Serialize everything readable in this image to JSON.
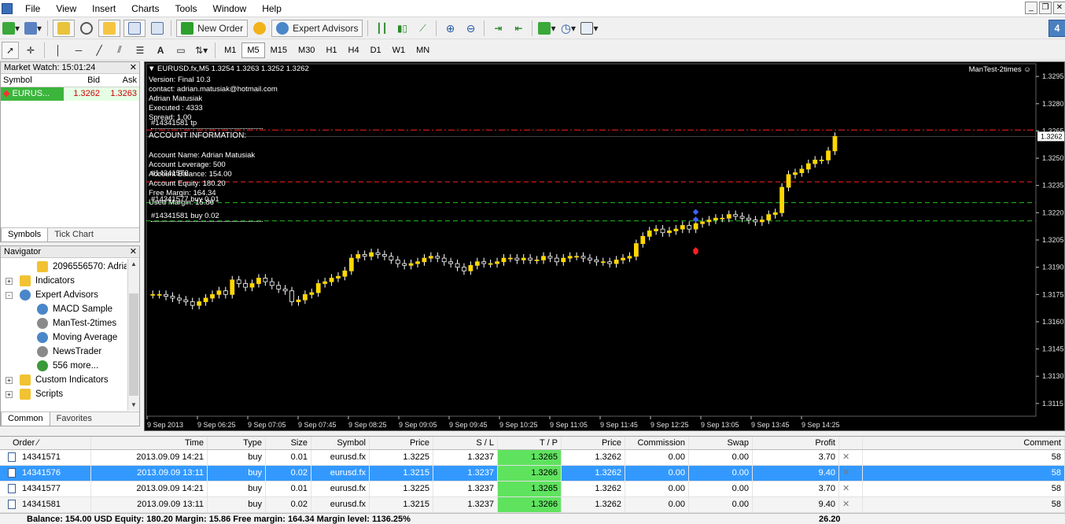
{
  "menu": [
    "File",
    "View",
    "Insert",
    "Charts",
    "Tools",
    "Window",
    "Help"
  ],
  "toolbar": {
    "new_order": "New Order",
    "expert_advisors": "Expert Advisors",
    "badge": "4",
    "timeframes": [
      "M1",
      "M5",
      "M15",
      "M30",
      "H1",
      "H4",
      "D1",
      "W1",
      "MN"
    ],
    "active_timeframe": "M5"
  },
  "market_watch": {
    "title": "Market Watch: 15:01:24",
    "columns": [
      "Symbol",
      "Bid",
      "Ask"
    ],
    "rows": [
      {
        "symbol": "EURUS...",
        "bid": "1.3262",
        "ask": "1.3263"
      }
    ],
    "tabs": [
      "Symbols",
      "Tick Chart"
    ]
  },
  "navigator": {
    "title": "Navigator",
    "items": [
      {
        "label": "2096556570: Adria",
        "icon": "account-icon",
        "indent": 2
      },
      {
        "label": "Indicators",
        "icon": "indicators-icon",
        "indent": 1,
        "expander": "+"
      },
      {
        "label": "Expert Advisors",
        "icon": "expert-icon",
        "indent": 1,
        "expander": "-"
      },
      {
        "label": "MACD Sample",
        "icon": "expert-icon",
        "indent": 2
      },
      {
        "label": "ManTest-2times",
        "icon": "expert-gray-icon",
        "indent": 2
      },
      {
        "label": "Moving Average",
        "icon": "expert-icon",
        "indent": 2
      },
      {
        "label": "NewsTrader",
        "icon": "expert-gray-icon",
        "indent": 2
      },
      {
        "label": "556 more...",
        "icon": "globe-icon",
        "indent": 2
      },
      {
        "label": "Custom Indicators",
        "icon": "indicators-icon",
        "indent": 1,
        "expander": "+"
      },
      {
        "label": "Scripts",
        "icon": "scripts-icon",
        "indent": 1,
        "expander": "+"
      }
    ],
    "tabs": [
      "Common",
      "Favorites"
    ]
  },
  "chart_panel": {
    "header": "EURUSD.fx,M5  1.3254 1.3263 1.3252 1.3262",
    "expert_name": "ManTest-2times",
    "info_lines": [
      "Version: Final 10.3",
      "contact: adrian.matusiak@hotmail.com",
      "Adrian Matusiak",
      "Executed : 4333",
      "Spread: 1.00"
    ],
    "account_title": "ACCOUNT INFORMATION:",
    "account_lines": [
      "Account Name:     Adrian Matusiak",
      "Account Leverage:     500",
      "Account Balance:     154.00",
      "Account Equity:     180.20",
      "Free Margin:     164.34",
      "Used Margin:     15.86"
    ],
    "line_labels": [
      "#14341581 tp",
      "#14341576",
      "#14341577 buy 0.01",
      "#14341581 buy 0.02"
    ],
    "current_price": "1.3262",
    "colors": {
      "candle": "#ffd700",
      "tp_line": "#ff2020",
      "sl_line": "#ff2020",
      "buy_line": "#20c020",
      "grid": "#505050"
    }
  },
  "chart_data": {
    "type": "candlestick",
    "symbol": "EURUSD.fx",
    "timeframe": "M5",
    "ylim": [
      1.3108,
      1.3302
    ],
    "y_ticks": [
      1.3295,
      1.328,
      1.3265,
      1.325,
      1.3235,
      1.322,
      1.3205,
      1.319,
      1.3175,
      1.316,
      1.3145,
      1.313,
      1.3115
    ],
    "x_ticks": [
      "9 Sep 2013",
      "9 Sep 06:25",
      "9 Sep 07:05",
      "9 Sep 07:45",
      "9 Sep 08:25",
      "9 Sep 09:05",
      "9 Sep 09:45",
      "9 Sep 10:25",
      "9 Sep 11:05",
      "9 Sep 11:45",
      "9 Sep 12:25",
      "9 Sep 13:05",
      "9 Sep 13:45",
      "9 Sep 14:25"
    ],
    "horizontal_lines": [
      {
        "price": 1.32655,
        "style": "dashdot",
        "color": "#ff2020"
      },
      {
        "price": 1.3237,
        "style": "dash",
        "color": "#ff2020"
      },
      {
        "price": 1.32255,
        "style": "dash",
        "color": "#20c020"
      },
      {
        "price": 1.32155,
        "style": "dash",
        "color": "#20c020"
      }
    ],
    "closes": [
      1.3175,
      1.3175,
      1.3174,
      1.3173,
      1.3172,
      1.3171,
      1.3169,
      1.3171,
      1.3173,
      1.3175,
      1.3177,
      1.3175,
      1.3183,
      1.3181,
      1.3179,
      1.3181,
      1.3184,
      1.3182,
      1.318,
      1.3178,
      1.3177,
      1.3171,
      1.3172,
      1.3175,
      1.3176,
      1.3181,
      1.3182,
      1.3184,
      1.3185,
      1.3188,
      1.3195,
      1.3197,
      1.3196,
      1.3198,
      1.3197,
      1.3196,
      1.3194,
      1.3192,
      1.3191,
      1.3192,
      1.3193,
      1.3195,
      1.3196,
      1.3195,
      1.3193,
      1.3192,
      1.319,
      1.3188,
      1.3191,
      1.3193,
      1.3192,
      1.3192,
      1.3193,
      1.3195,
      1.3195,
      1.3194,
      1.3195,
      1.3194,
      1.3194,
      1.3196,
      1.3195,
      1.3193,
      1.3195,
      1.3196,
      1.3196,
      1.3195,
      1.3194,
      1.3193,
      1.3193,
      1.3192,
      1.3194,
      1.3195,
      1.3196,
      1.3203,
      1.3207,
      1.321,
      1.3211,
      1.3209,
      1.321,
      1.3211,
      1.3213,
      1.3211,
      1.3214,
      1.3215,
      1.3216,
      1.3217,
      1.3217,
      1.3219,
      1.3218,
      1.3217,
      1.3216,
      1.3215,
      1.3216,
      1.3219,
      1.322,
      1.3234,
      1.3241,
      1.3242,
      1.3244,
      1.3247,
      1.3249,
      1.3249,
      1.3254,
      1.3262
    ]
  },
  "terminal": {
    "columns": [
      "Order",
      "Time",
      "Type",
      "Size",
      "Symbol",
      "Price",
      "S / L",
      "T / P",
      "Price",
      "Commission",
      "Swap",
      "Profit",
      "",
      "Comment"
    ],
    "rows": [
      {
        "order": "14341571",
        "time": "2013.09.09 14:21",
        "type": "buy",
        "size": "0.01",
        "symbol": "eurusd.fx",
        "price": "1.3225",
        "sl": "1.3237",
        "tp": "1.3265",
        "cur": "1.3262",
        "commission": "0.00",
        "swap": "0.00",
        "profit": "3.70",
        "comment": "58"
      },
      {
        "order": "14341576",
        "time": "2013.09.09 13:11",
        "type": "buy",
        "size": "0.02",
        "symbol": "eurusd.fx",
        "price": "1.3215",
        "sl": "1.3237",
        "tp": "1.3266",
        "cur": "1.3262",
        "commission": "0.00",
        "swap": "0.00",
        "profit": "9.40",
        "comment": "58"
      },
      {
        "order": "14341577",
        "time": "2013.09.09 14:21",
        "type": "buy",
        "size": "0.01",
        "symbol": "eurusd.fx",
        "price": "1.3225",
        "sl": "1.3237",
        "tp": "1.3265",
        "cur": "1.3262",
        "commission": "0.00",
        "swap": "0.00",
        "profit": "3.70",
        "comment": "58"
      },
      {
        "order": "14341581",
        "time": "2013.09.09 13:11",
        "type": "buy",
        "size": "0.02",
        "symbol": "eurusd.fx",
        "price": "1.3215",
        "sl": "1.3237",
        "tp": "1.3266",
        "cur": "1.3262",
        "commission": "0.00",
        "swap": "0.00",
        "profit": "9.40",
        "comment": "58"
      }
    ],
    "close_glyph": "✕",
    "balance_line": "Balance: 154.00 USD  Equity: 180.20  Margin: 15.86  Free margin: 164.34  Margin level: 1136.25%",
    "balance_total": "26.20"
  }
}
